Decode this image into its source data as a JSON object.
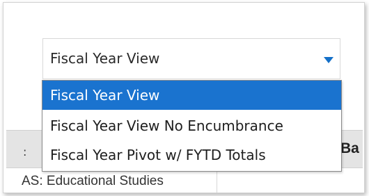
{
  "select": {
    "value": "Fiscal Year View",
    "caret_color": "#1470c8"
  },
  "dropdown": {
    "options": [
      {
        "label": "Fiscal Year View",
        "selected": true
      },
      {
        "label": "Fiscal Year View No Encumbrance",
        "selected": false
      },
      {
        "label": "Fiscal Year Pivot w/ FYTD Totals",
        "selected": false
      }
    ],
    "highlight_color": "#1a73cf"
  },
  "background": {
    "header_fragment": "Ba",
    "left_fragment": ":",
    "row_text": "AS: Educational Studies"
  }
}
